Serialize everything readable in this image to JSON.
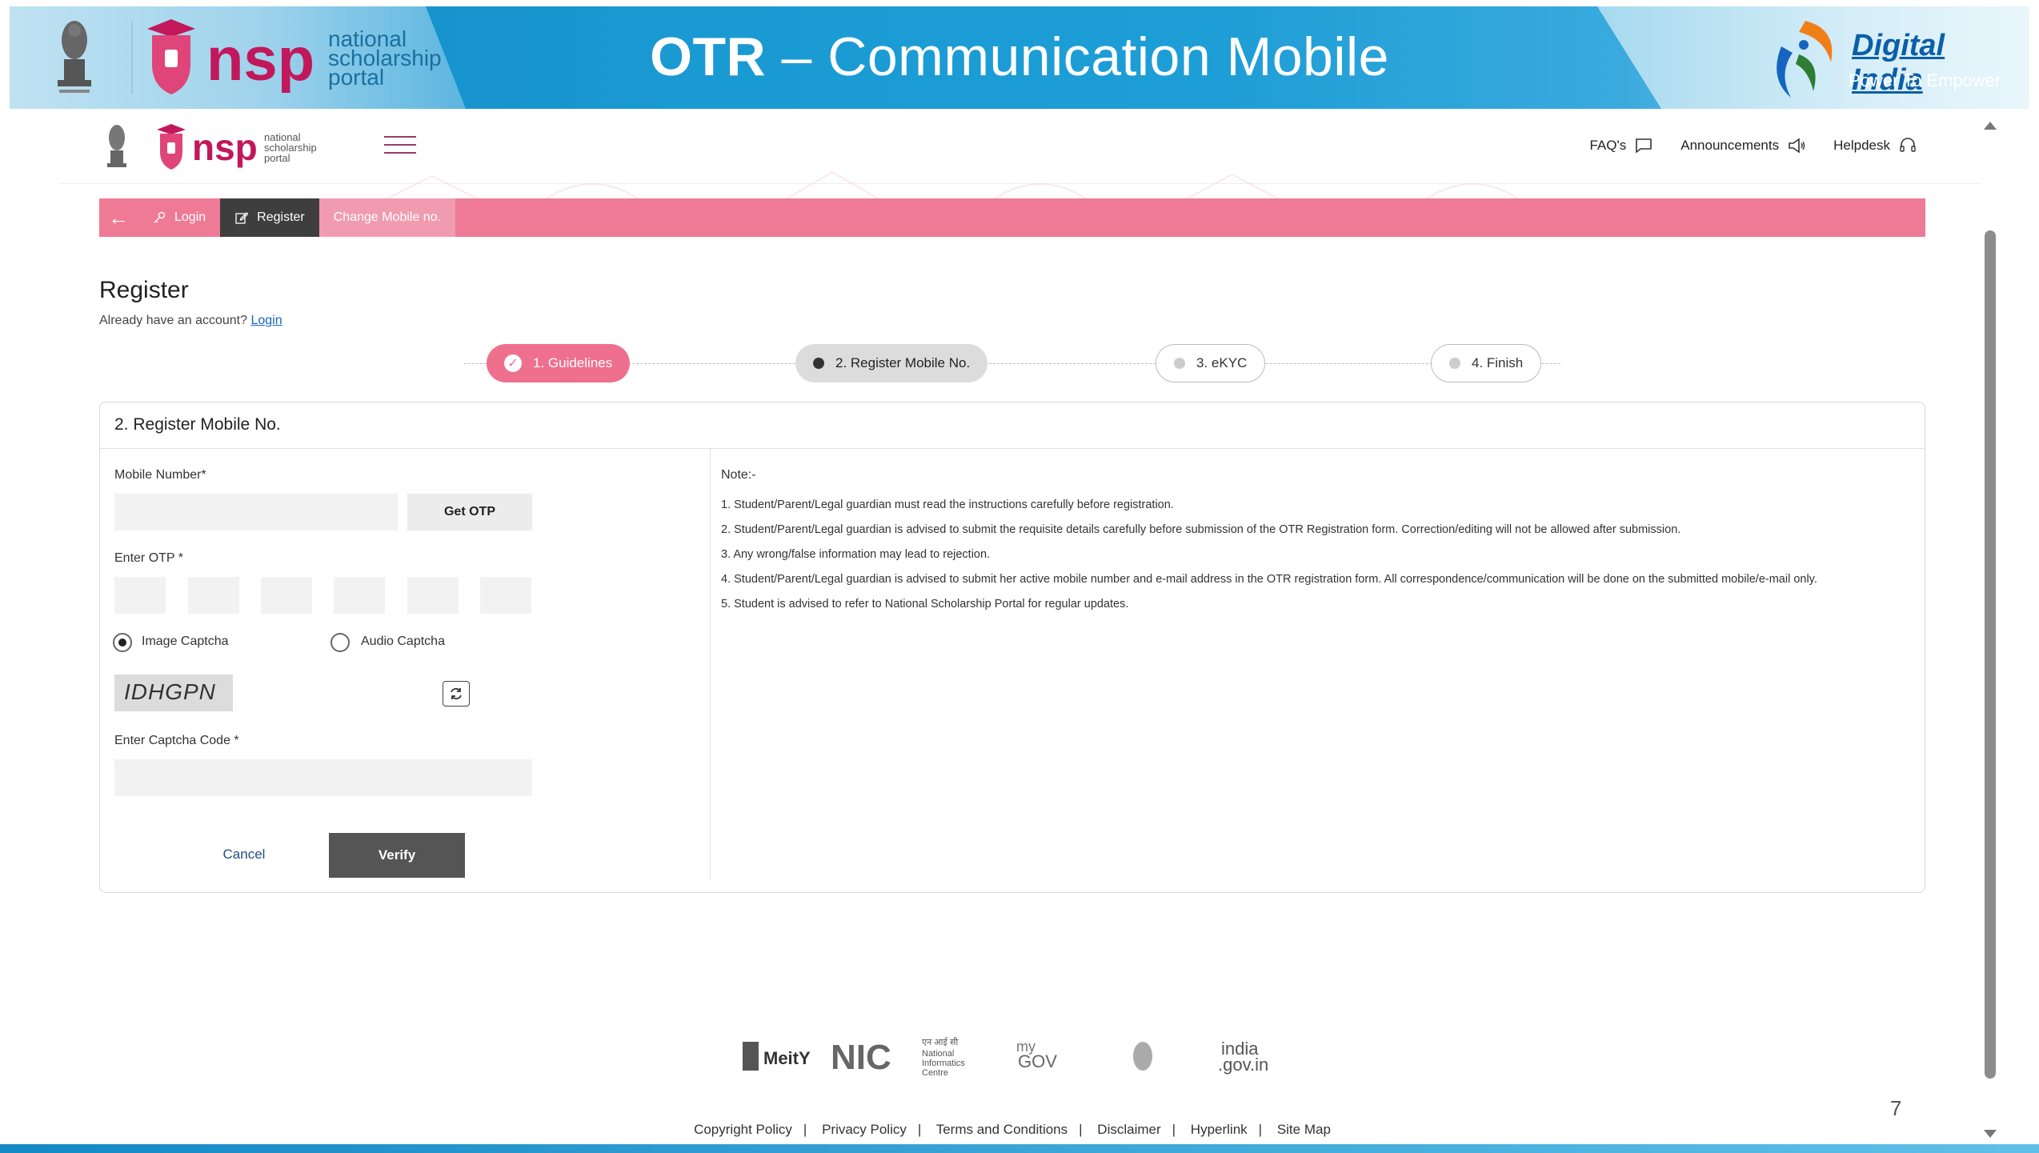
{
  "slide": {
    "title_bold": "OTR",
    "title_rest": " – Communication Mobile",
    "page_number": "7",
    "nsp_logo": {
      "line1": "national",
      "line2": "scholarship",
      "line3": "portal",
      "mark": "nsp"
    },
    "digital_india": {
      "line1": "Digital India",
      "line2": "Power To Empower"
    }
  },
  "header": {
    "links": [
      {
        "label": "FAQ's",
        "icon": "chat-icon"
      },
      {
        "label": "Announcements",
        "icon": "megaphone-icon"
      },
      {
        "label": "Helpdesk",
        "icon": "headset-icon"
      }
    ]
  },
  "navbar": {
    "back_icon": "←",
    "items": [
      {
        "label": "Login",
        "icon": "key-icon"
      },
      {
        "label": "Register",
        "icon": "edit-icon"
      },
      {
        "label": "Change Mobile no."
      }
    ]
  },
  "page": {
    "title": "Register",
    "subtitle": "Already have an account?",
    "login_link": "Login"
  },
  "stepper": {
    "steps": [
      {
        "label": "1. Guidelines",
        "state": "done"
      },
      {
        "label": "2. Register Mobile No.",
        "state": "active"
      },
      {
        "label": "3. eKYC",
        "state": "pending"
      },
      {
        "label": "4. Finish",
        "state": "pending"
      }
    ]
  },
  "form": {
    "card_title": "2. Register Mobile No.",
    "mobile_label": "Mobile Number*",
    "mobile_value": "",
    "get_otp_label": "Get OTP",
    "otp_label": "Enter OTP *",
    "otp_digits": [
      "",
      "",
      "",
      "",
      "",
      ""
    ],
    "captcha_options": [
      {
        "label": "Image Captcha",
        "selected": true
      },
      {
        "label": "Audio Captcha",
        "selected": false
      }
    ],
    "captcha_text": "IDHGPN",
    "captcha_code_label": "Enter Captcha Code *",
    "captcha_code_value": "",
    "cancel_label": "Cancel",
    "verify_label": "Verify"
  },
  "notes": {
    "title": "Note:-",
    "items": [
      "1. Student/Parent/Legal guardian must read the instructions carefully before registration.",
      "2. Student/Parent/Legal guardian is advised to submit the requisite details carefully before submission of the OTR Registration form. Correction/editing will not be allowed after submission.",
      "3. Any wrong/false information may lead to rejection.",
      "4. Student/Parent/Legal guardian is advised to submit her active mobile number and e-mail address in the OTR registration form. All correspondence/communication will be done on the submitted mobile/e-mail only.",
      "5. Student is advised to refer to National Scholarship Portal for regular updates."
    ]
  },
  "footer": {
    "logos": [
      "MeitY",
      "NIC",
      "MyGov",
      "emblem",
      "india.gov.in"
    ],
    "logo_texts": {
      "meity": "MeitY",
      "nic": "NIC",
      "nic_hindi": "एन आई सी",
      "nic_line1": "National",
      "nic_line2": "Informatics",
      "nic_line3": "Centre",
      "mygov_my": "my",
      "mygov_gov": "GOV",
      "indiagov_1": "india",
      "indiagov_2": ".gov.in"
    },
    "links": [
      "Copyright Policy",
      "Privacy Policy",
      "Terms and Conditions",
      "Disclaimer",
      "Hyperlink",
      "Site Map"
    ],
    "separator": "|"
  },
  "colors": {
    "banner_blue": "#1a9ad3",
    "nav_pink": "#ef7a96",
    "nav_active": "#3e3e3e",
    "step_done": "#ef6f8e",
    "verify_button": "#555555"
  }
}
